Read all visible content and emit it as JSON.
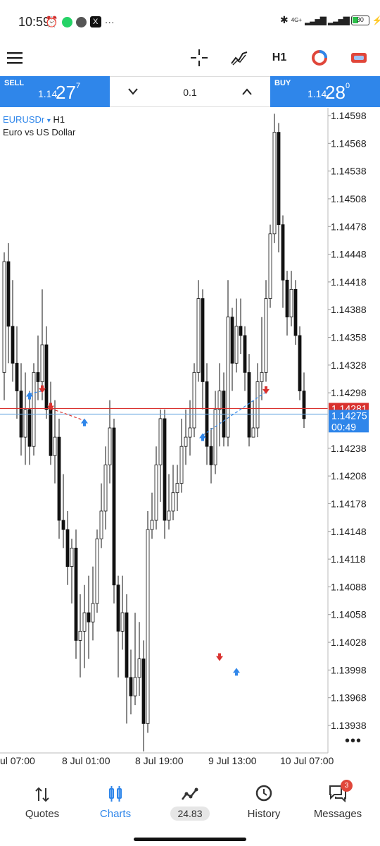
{
  "status_bar": {
    "time": "10:59",
    "battery": "30",
    "network": "4G+"
  },
  "toolbar": {
    "timeframe": "H1"
  },
  "trade": {
    "sell": {
      "label": "SELL",
      "price_prefix": "1.14",
      "price_big": "27",
      "price_sup": "7"
    },
    "volume": "0.1",
    "buy": {
      "label": "BUY",
      "price_prefix": "1.14",
      "price_big": "28",
      "price_sup": "0"
    }
  },
  "chart_info": {
    "symbol": "EURUSDr",
    "symbol_arrow": "▾",
    "timeframe": "H1",
    "description": "Euro vs US Dollar"
  },
  "chart_data": {
    "type": "candlestick",
    "symbol": "EURUSDr",
    "timeframe": "H1",
    "price_ticks": [
      "1.14598",
      "1.14568",
      "1.14538",
      "1.14508",
      "1.14478",
      "1.14448",
      "1.14418",
      "1.14388",
      "1.14358",
      "1.14328",
      "1.14298",
      "1.14238",
      "1.14208",
      "1.14178",
      "1.14148",
      "1.14118",
      "1.14088",
      "1.14058",
      "1.14028",
      "1.13998",
      "1.13968",
      "1.13938"
    ],
    "time_ticks": [
      "ul 07:00",
      "8 Jul 01:00",
      "8 Jul 19:00",
      "9 Jul 13:00",
      "10 Jul 07:00"
    ],
    "ask_line": {
      "label": "1.14281",
      "value": 1.14281,
      "color": "#d9312e"
    },
    "bid_line": {
      "label": "1.14275",
      "value": 1.14275,
      "color": "#2f86ea"
    },
    "countdown": "00:49",
    "ylim": [
      1.1391,
      1.1461
    ],
    "candles": [
      [
        1.1432,
        1.1444,
        1.1445,
        1.1429
      ],
      [
        1.1444,
        1.1437,
        1.1446,
        1.1433
      ],
      [
        1.1437,
        1.1433,
        1.1442,
        1.1431
      ],
      [
        1.1433,
        1.143,
        1.1437,
        1.1427
      ],
      [
        1.143,
        1.1425,
        1.1433,
        1.1423
      ],
      [
        1.1425,
        1.1428,
        1.1432,
        1.1422
      ],
      [
        1.1428,
        1.1424,
        1.143,
        1.1422
      ],
      [
        1.1424,
        1.1432,
        1.1433,
        1.1423
      ],
      [
        1.1432,
        1.1431,
        1.1436,
        1.1429
      ],
      [
        1.1431,
        1.1435,
        1.1441,
        1.1429
      ],
      [
        1.1435,
        1.1428,
        1.1437,
        1.1427
      ],
      [
        1.1428,
        1.1423,
        1.1431,
        1.1422
      ],
      [
        1.1423,
        1.1425,
        1.1429,
        1.142
      ],
      [
        1.1425,
        1.1416,
        1.1427,
        1.1414
      ],
      [
        1.1416,
        1.1415,
        1.1421,
        1.1413
      ],
      [
        1.1415,
        1.1411,
        1.1417,
        1.1409
      ],
      [
        1.1411,
        1.1413,
        1.1414,
        1.1407
      ],
      [
        1.1413,
        1.1403,
        1.1415,
        1.1401
      ],
      [
        1.1403,
        1.1404,
        1.1408,
        1.1399
      ],
      [
        1.1404,
        1.1406,
        1.1409,
        1.14
      ],
      [
        1.1406,
        1.1405,
        1.141,
        1.1401
      ],
      [
        1.1405,
        1.1407,
        1.1411,
        1.1403
      ],
      [
        1.1407,
        1.1414,
        1.1415,
        1.1406
      ],
      [
        1.1414,
        1.1417,
        1.142,
        1.1413
      ],
      [
        1.1417,
        1.1422,
        1.1424,
        1.1415
      ],
      [
        1.1422,
        1.1426,
        1.1429,
        1.142
      ],
      [
        1.1426,
        1.1409,
        1.1427,
        1.1407
      ],
      [
        1.1409,
        1.1404,
        1.141,
        1.1399
      ],
      [
        1.1404,
        1.1406,
        1.141,
        1.1402
      ],
      [
        1.1406,
        1.1399,
        1.1408,
        1.1394
      ],
      [
        1.1399,
        1.1397,
        1.1402,
        1.1395
      ],
      [
        1.1397,
        1.1399,
        1.1406,
        1.1396
      ],
      [
        1.1399,
        1.1401,
        1.1405,
        1.1397
      ],
      [
        1.1401,
        1.1394,
        1.1403,
        1.1391
      ],
      [
        1.1394,
        1.1415,
        1.1417,
        1.1393
      ],
      [
        1.1415,
        1.1416,
        1.1419,
        1.1414
      ],
      [
        1.1416,
        1.1422,
        1.1424,
        1.1415
      ],
      [
        1.1422,
        1.1427,
        1.1428,
        1.1418
      ],
      [
        1.1427,
        1.1416,
        1.1428,
        1.1414
      ],
      [
        1.1416,
        1.1417,
        1.1421,
        1.1415
      ],
      [
        1.1417,
        1.1419,
        1.1422,
        1.1416
      ],
      [
        1.1419,
        1.142,
        1.1422,
        1.1417
      ],
      [
        1.142,
        1.1424,
        1.1427,
        1.1419
      ],
      [
        1.1424,
        1.1425,
        1.1428,
        1.1422
      ],
      [
        1.1425,
        1.1426,
        1.1429,
        1.1423
      ],
      [
        1.1426,
        1.1432,
        1.1433,
        1.1425
      ],
      [
        1.1432,
        1.144,
        1.1442,
        1.1431
      ],
      [
        1.144,
        1.1431,
        1.1441,
        1.1428
      ],
      [
        1.1431,
        1.1424,
        1.1433,
        1.1422
      ],
      [
        1.1424,
        1.1422,
        1.1426,
        1.142
      ],
      [
        1.1422,
        1.1428,
        1.143,
        1.1421
      ],
      [
        1.1428,
        1.143,
        1.1433,
        1.1424
      ],
      [
        1.143,
        1.1425,
        1.1432,
        1.1424
      ],
      [
        1.1425,
        1.1438,
        1.1442,
        1.1424
      ],
      [
        1.1438,
        1.1433,
        1.1439,
        1.143
      ],
      [
        1.1433,
        1.1437,
        1.144,
        1.1432
      ],
      [
        1.1437,
        1.1436,
        1.144,
        1.1434
      ],
      [
        1.1436,
        1.1432,
        1.1437,
        1.143
      ],
      [
        1.1432,
        1.1425,
        1.1434,
        1.1424
      ],
      [
        1.1425,
        1.1426,
        1.1429,
        1.1425
      ],
      [
        1.1426,
        1.1431,
        1.1433,
        1.1425
      ],
      [
        1.1431,
        1.1432,
        1.1438,
        1.1429
      ],
      [
        1.1432,
        1.144,
        1.1442,
        1.1431
      ],
      [
        1.144,
        1.1447,
        1.1448,
        1.1439
      ],
      [
        1.1447,
        1.1458,
        1.146,
        1.1446
      ],
      [
        1.1458,
        1.1448,
        1.1459,
        1.1445
      ],
      [
        1.1448,
        1.1442,
        1.1449,
        1.1439
      ],
      [
        1.1442,
        1.1438,
        1.1443,
        1.1436
      ],
      [
        1.1438,
        1.1441,
        1.1443,
        1.1437
      ],
      [
        1.1441,
        1.1436,
        1.1442,
        1.1435
      ],
      [
        1.1436,
        1.143,
        1.1437,
        1.1429
      ],
      [
        1.143,
        1.1427,
        1.1432,
        1.1426
      ]
    ],
    "buy_markers": [
      [
        6,
        1.14297
      ],
      [
        19,
        1.14268
      ],
      [
        47,
        1.14252
      ],
      [
        55,
        1.13998
      ]
    ],
    "sell_markers": [
      [
        9,
        1.143
      ],
      [
        11,
        1.14281
      ],
      [
        51,
        1.1401
      ],
      [
        62,
        1.14299
      ]
    ]
  },
  "bottom_nav": [
    {
      "label": "Quotes",
      "icon": "quotes-icon"
    },
    {
      "label": "Charts",
      "icon": "charts-icon"
    },
    {
      "label": "24.83",
      "icon": "trade-icon"
    },
    {
      "label": "History",
      "icon": "history-icon"
    },
    {
      "label": "Messages",
      "icon": "messages-icon",
      "badge": "3"
    }
  ],
  "colors": {
    "accent": "#2f86ea",
    "sell": "#d9312e",
    "bull": "#ffffff",
    "bear": "#111111"
  }
}
